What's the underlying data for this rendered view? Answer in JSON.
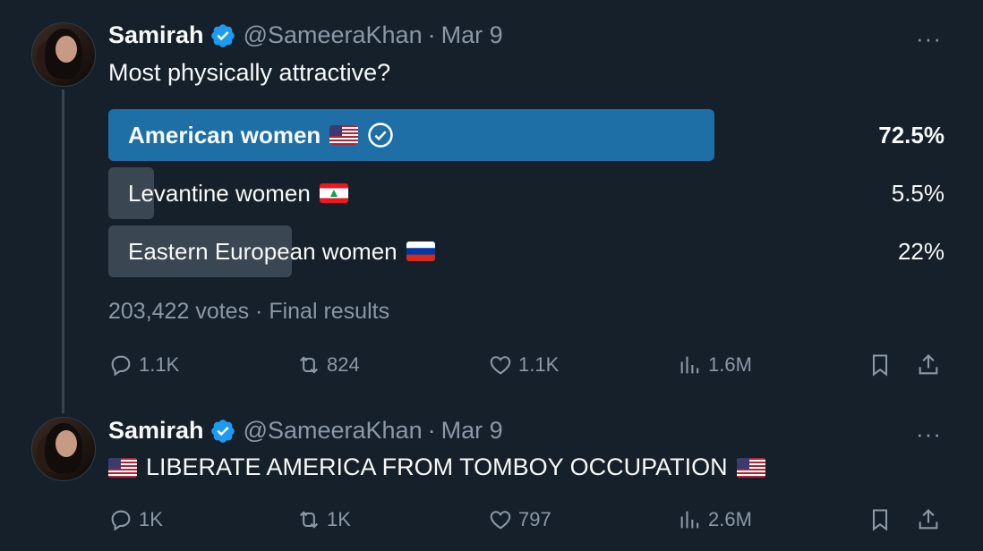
{
  "colors": {
    "background": "#15202b",
    "text_primary": "#f7f9f9",
    "text_secondary": "#8b98a5",
    "poll_winner_bar": "#1d6fa5",
    "poll_other_bar": "#3a4651",
    "verified_blue": "#1d9bf0"
  },
  "tweets": [
    {
      "author_name": "Samirah",
      "handle": "@SameeraKhan",
      "separator": "·",
      "date": "Mar 9",
      "more_label": "···",
      "text": "Most physically attractive?",
      "poll": {
        "options": [
          {
            "label": "American women",
            "flag": "us-flag-icon",
            "percent_label": "72.5%",
            "fraction": 0.725,
            "winner": true
          },
          {
            "label": "Levantine women",
            "flag": "lebanon-flag-icon",
            "percent_label": "5.5%",
            "fraction": 0.055,
            "winner": false
          },
          {
            "label": "Eastern European women",
            "flag": "russia-flag-icon",
            "percent_label": "22%",
            "fraction": 0.22,
            "winner": false
          }
        ],
        "votes": "203,422 votes",
        "separator": "·",
        "status": "Final results"
      },
      "actions": {
        "replies": "1.1K",
        "retweets": "824",
        "likes": "1.1K",
        "views": "1.6M"
      }
    },
    {
      "author_name": "Samirah",
      "handle": "@SameeraKhan",
      "separator": "·",
      "date": "Mar 9",
      "more_label": "···",
      "text": "LIBERATE AMERICA FROM TOMBOY OCCUPATION",
      "actions": {
        "replies": "1K",
        "retweets": "1K",
        "likes": "797",
        "views": "2.6M"
      }
    }
  ]
}
